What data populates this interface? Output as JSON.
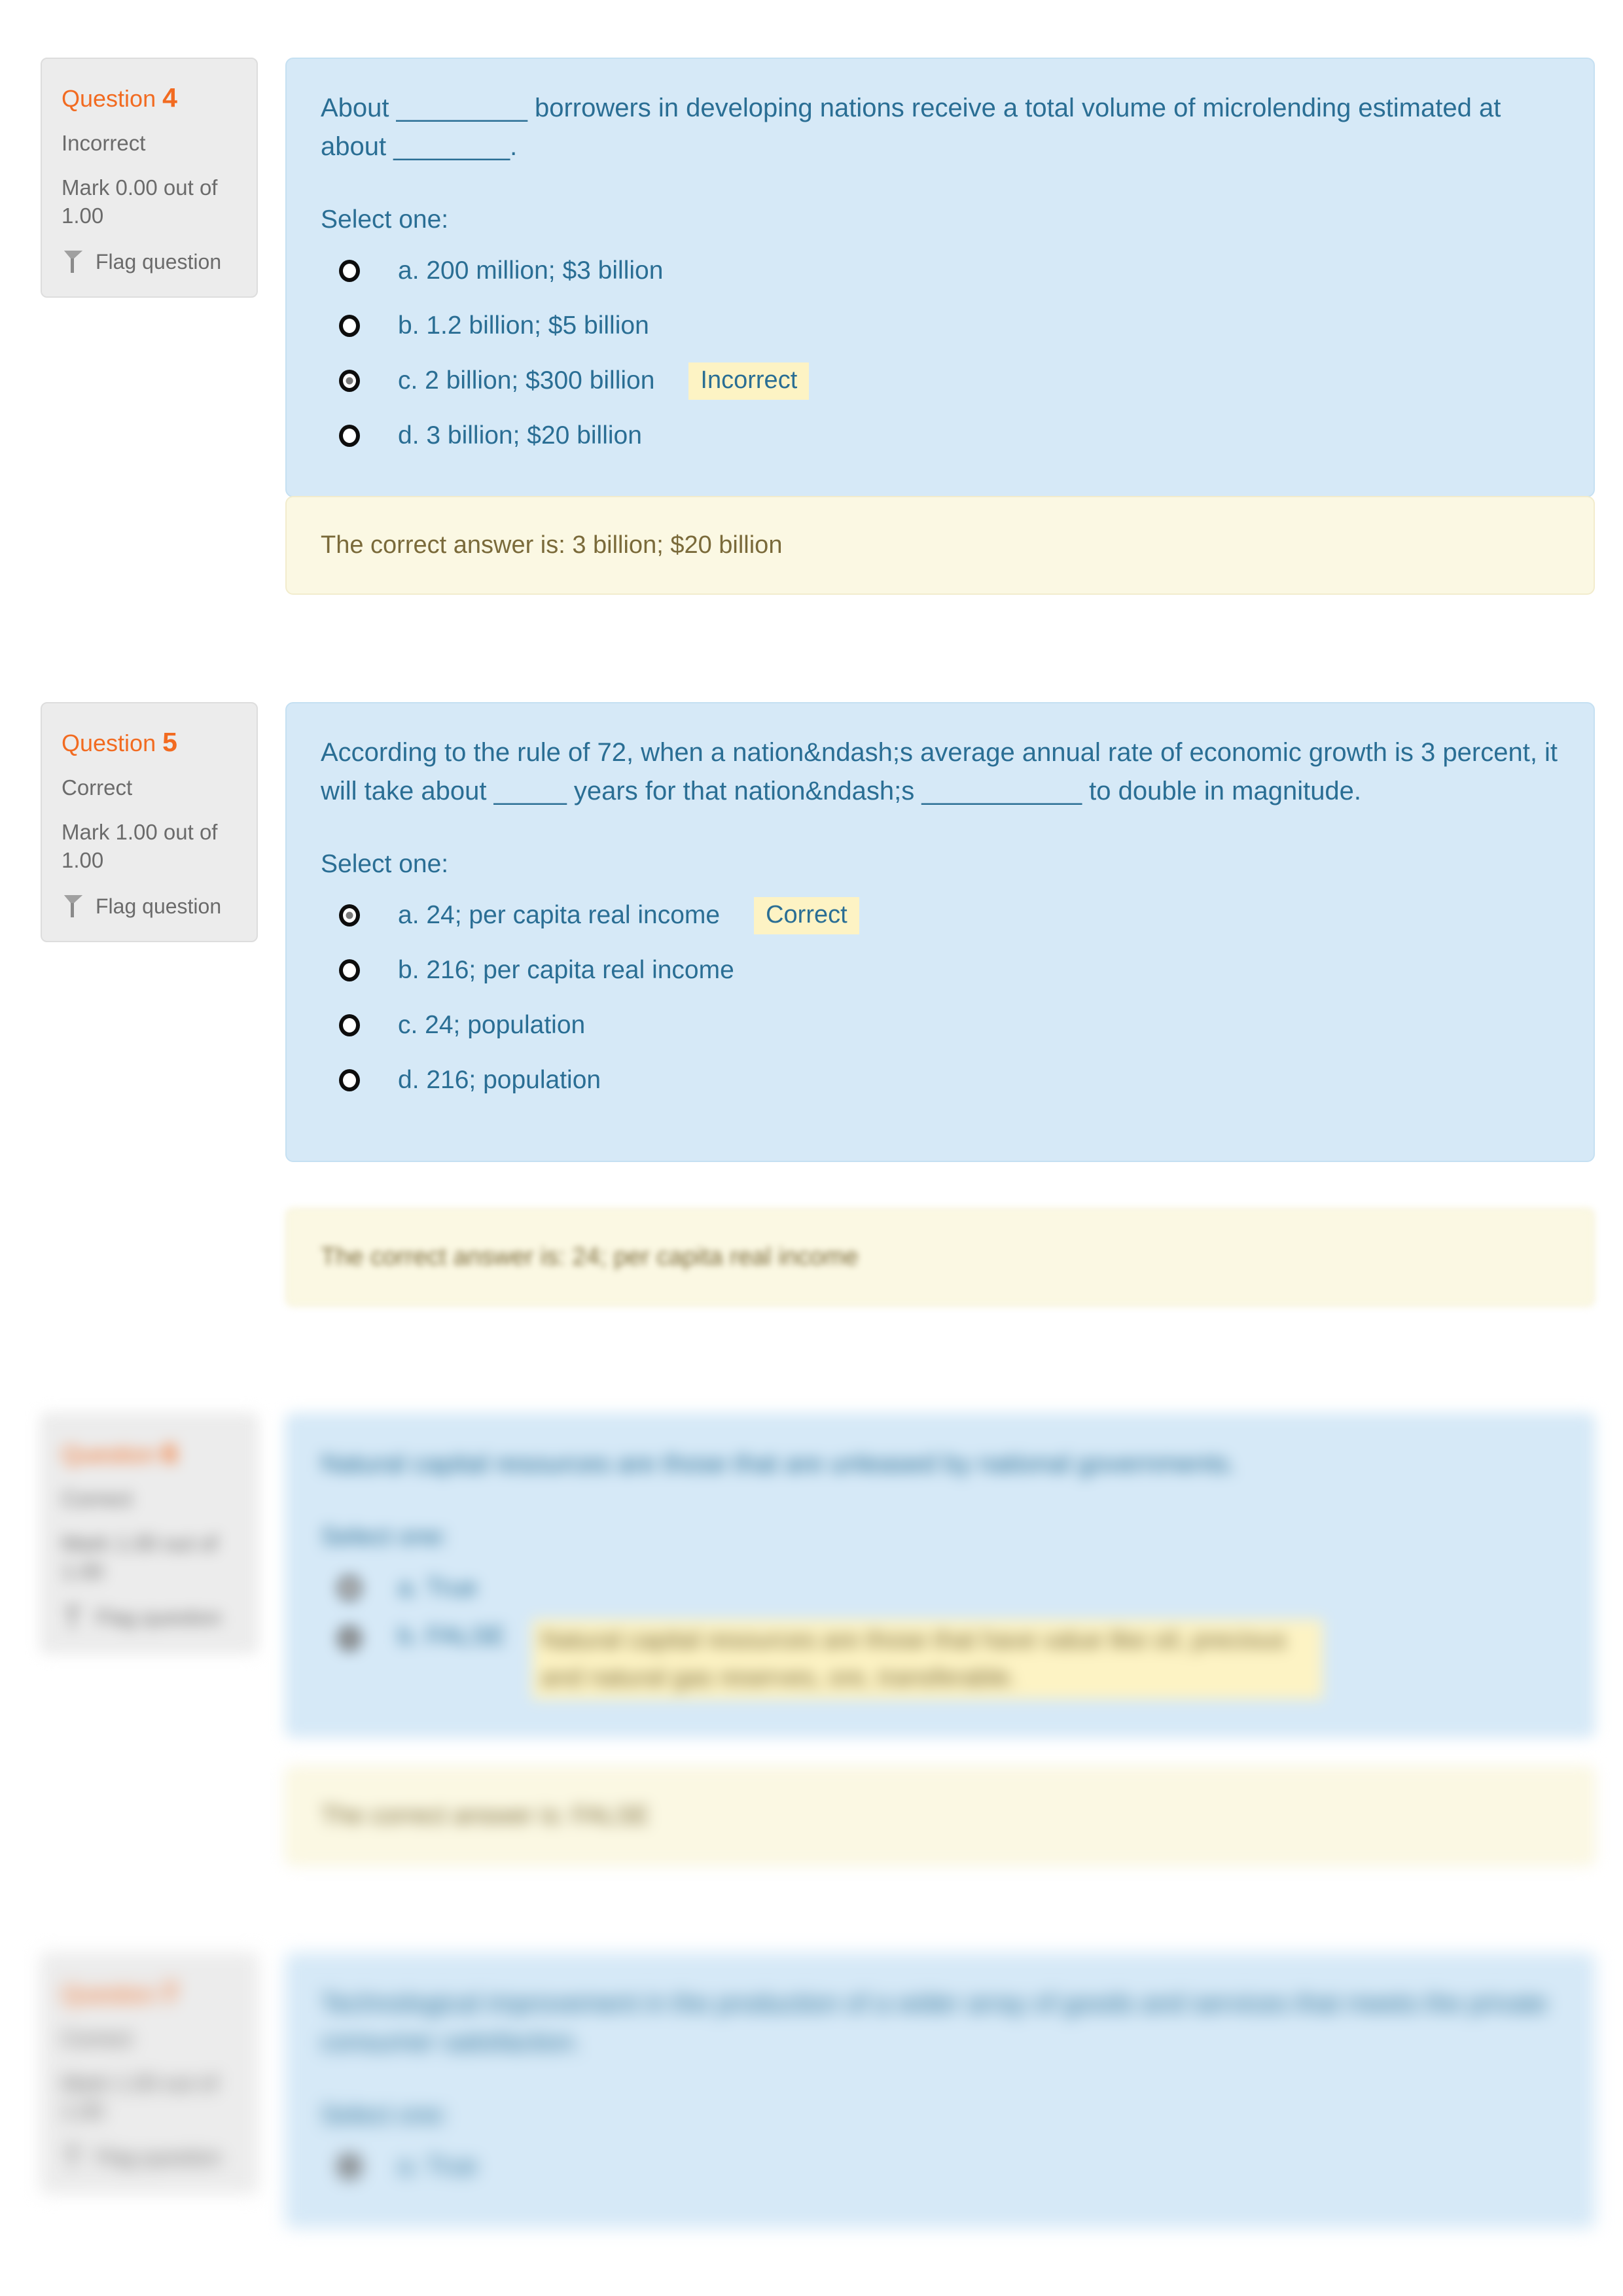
{
  "theme": {
    "page_background": "#ffffff",
    "info_panel_background": "#ececec",
    "content_panel_background": "#d6e9f7",
    "feedback_panel_background": "#fbf8e3",
    "question_number_color": "#f26b21",
    "body_text_color": "#2a6e94",
    "feedback_text_color": "#7a6a3a",
    "badge_background": "#fdf3c4",
    "muted_text_color": "#6b6b6b"
  },
  "labels": {
    "question_word": "Question",
    "flag_question": "Flag question",
    "select_one": "Select one:"
  },
  "questions": [
    {
      "number": "4",
      "state": "Incorrect",
      "mark": "Mark 0.00 out of 1.00",
      "flag_label": "Flag question",
      "text": "About _________ borrowers in developing nations receive a total volume of microlending estimated at about ________.",
      "select_one": "Select one:",
      "options": [
        {
          "label": "a. 200 million; $3 billion",
          "checked": false,
          "badge": ""
        },
        {
          "label": "b. 1.2 billion; $5 billion",
          "checked": false,
          "badge": ""
        },
        {
          "label": "c. 2 billion; $300 billion",
          "checked": true,
          "badge": "Incorrect"
        },
        {
          "label": "d. 3 billion; $20 billion",
          "checked": false,
          "badge": ""
        }
      ],
      "feedback": "The correct answer is: 3 billion; $20 billion"
    },
    {
      "number": "5",
      "state": "Correct",
      "mark": "Mark 1.00 out of 1.00",
      "flag_label": "Flag question",
      "text": "According to the rule of 72, when a nation&ndash;s average annual rate of economic growth is 3 percent, it will take about _____ years for that nation&ndash;s ___________ to double in magnitude.",
      "select_one": "Select one:",
      "options": [
        {
          "label": "a. 24; per capita real income",
          "checked": true,
          "badge": "Correct"
        },
        {
          "label": "b. 216; per capita real income",
          "checked": false,
          "badge": ""
        },
        {
          "label": "c. 24; population",
          "checked": false,
          "badge": ""
        },
        {
          "label": "d. 216; population",
          "checked": false,
          "badge": ""
        }
      ],
      "feedback": "The correct answer is: 24; per capita real income"
    },
    {
      "number": "6",
      "state": "Correct",
      "mark": "Mark 1.00 out of 1.00",
      "flag_label": "Flag question",
      "text": "Natural capital resources are those that are unleased by national governments.",
      "select_one": "Select one:",
      "options": [
        {
          "label": "a. True",
          "checked": false,
          "badge": ""
        },
        {
          "label": "b. FALSE",
          "checked": true,
          "badge": "Natural capital resources are those that have value like oil, precious and natural gas reserves, ore, transferable."
        }
      ],
      "feedback": "The correct answer is: FALSE"
    },
    {
      "number": "7",
      "state": "Correct",
      "mark": "Mark 1.00 out of 1.00",
      "flag_label": "Flag question",
      "text": "Technological improvement in the production of a wider array of goods and services that meets the private consumer satisfaction.",
      "select_one": "Select one:",
      "options": [
        {
          "label": "a. True",
          "checked": true,
          "badge": ""
        }
      ],
      "feedback": ""
    }
  ]
}
